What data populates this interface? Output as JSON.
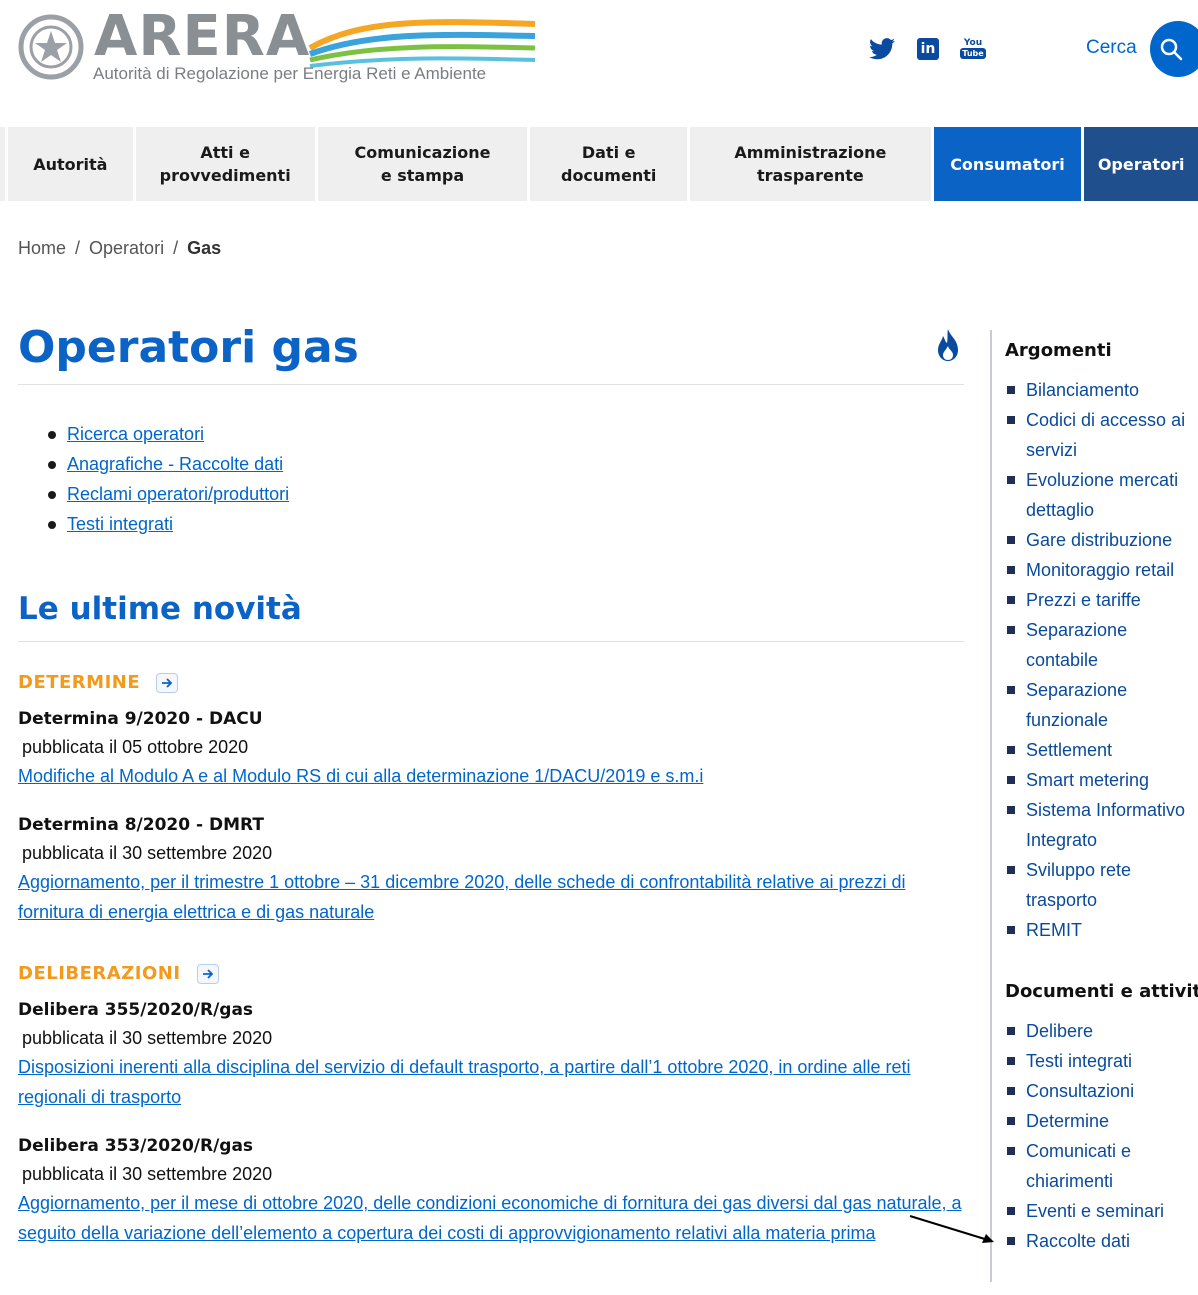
{
  "header": {
    "logo_text": "ARERA",
    "logo_subtitle": "Autorità di Regolazione per Energia Reti e Ambiente",
    "social": [
      {
        "name": "twitter-icon"
      },
      {
        "name": "linkedin-icon",
        "glyph": "in"
      },
      {
        "name": "youtube-icon",
        "glyph_top": "You",
        "glyph_bottom": "Tube"
      }
    ],
    "search_label": "Cerca"
  },
  "nav": [
    {
      "label": "Autorità"
    },
    {
      "label": "Atti e provvedimenti"
    },
    {
      "label": "Comunicazione e stampa"
    },
    {
      "label": "Dati e documenti"
    },
    {
      "label": "Amministrazione trasparente"
    },
    {
      "label": "Consumatori"
    },
    {
      "label": "Operatori"
    }
  ],
  "breadcrumb": {
    "home": "Home",
    "sep": "/",
    "parent": "Operatori",
    "current": "Gas"
  },
  "main": {
    "title": "Operatori gas",
    "quick_links": [
      "Ricerca operatori",
      "Anagrafiche - Raccolte dati",
      "Reclami operatori/produttori",
      "Testi integrati"
    ],
    "news_title": "Le ultime novità",
    "categories": [
      {
        "label": "DETERMINE",
        "items": [
          {
            "title": "Determina  9/2020 - DACU",
            "date": "pubblicata il 05 ottobre 2020",
            "desc": "Modifiche al Modulo A e al Modulo RS di cui alla determinazione 1/DACU/2019 e s.m.i"
          },
          {
            "title": "Determina  8/2020 - DMRT",
            "date": "pubblicata il 30 settembre 2020",
            "desc": "Aggiornamento, per il trimestre 1 ottobre – 31 dicembre 2020, delle schede di confrontabilità relative ai prezzi di fornitura di energia elettrica e di gas naturale"
          }
        ]
      },
      {
        "label": "DELIBERAZIONI",
        "items": [
          {
            "title": "Delibera  355/2020/R/gas",
            "date": "pubblicata il 30 settembre 2020",
            "desc": "Disposizioni inerenti alla disciplina del servizio di default trasporto, a partire dall’1 ottobre 2020, in ordine alle reti regionali di trasporto"
          },
          {
            "title": "Delibera  353/2020/R/gas",
            "date": "pubblicata il 30 settembre 2020",
            "desc": "Aggiornamento, per il mese di ottobre 2020, delle condizioni economiche di fornitura dei gas diversi dal gas naturale, a seguito della variazione dell’elemento a copertura dei costi di approvvigionamento relativi alla materia prima"
          }
        ]
      }
    ]
  },
  "sidebar": {
    "topics_title": "Argomenti",
    "topics": [
      "Bilanciamento",
      "Codici di accesso ai servizi",
      "Evoluzione mercati dettaglio",
      "Gare distribuzione",
      "Monitoraggio retail",
      "Prezzi e tariffe",
      "Separazione contabile",
      "Separazione funzionale",
      "Settlement",
      "Smart metering",
      "Sistema Informativo Integrato",
      "Sviluppo rete trasporto",
      "REMIT"
    ],
    "docs_title": "Documenti e attività",
    "docs": [
      "Delibere",
      "Testi integrati",
      "Consultazioni",
      "Determine",
      "Comunicati e chiarimenti",
      "Eventi e seminari",
      "Raccolte dati"
    ]
  },
  "colors": {
    "brand_blue": "#0b63c5",
    "operatori_blue": "#1f4f8c",
    "category_orange": "#f39a1d",
    "link_blue": "#0066cc"
  }
}
